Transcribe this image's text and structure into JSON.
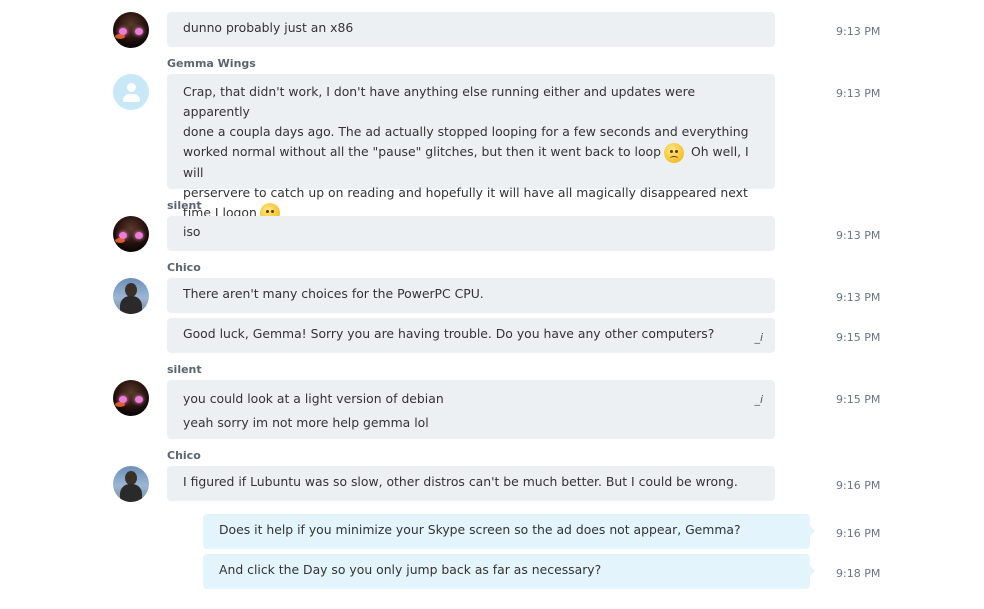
{
  "messages": [
    {
      "sender": "silent",
      "text": "dunno probably just an x86",
      "time": "9:13 PM"
    },
    {
      "sender": "Gemma Wings",
      "text_lines": [
        "Crap, that didn't work, I don't have anything else running either and updates were apparently",
        "done a coupla days ago.  The ad actually stopped looping for a few seconds and everything",
        "worked normal without all the \"pause\" glitches, but then it went back to loop",
        "Oh well, I will",
        "perservere to catch up on reading and hopefully it will have all magically disappeared next",
        "time I logon"
      ],
      "time": "9:13 PM"
    },
    {
      "sender": "silent",
      "text": "iso",
      "time": "9:13 PM"
    },
    {
      "sender": "Chico",
      "text": "There aren't many choices for the PowerPC CPU.",
      "time": "9:13 PM"
    },
    {
      "sender": "Chico",
      "text": "Good luck, Gemma!  Sorry you are having trouble.  Do you have any other computers?",
      "time": "9:15 PM",
      "edited_mark": "_i"
    },
    {
      "sender": "silent",
      "text_lines": [
        "you could look at a light version of debian",
        "yeah sorry im not more help gemma lol"
      ],
      "time": "9:15 PM",
      "edited_mark": "_i"
    },
    {
      "sender": "Chico",
      "text": "I figured if Lubuntu was so slow, other distros can't be much better.  But I could be wrong.",
      "time": "9:16 PM"
    },
    {
      "sender": "me",
      "text": "Does it help if you minimize your Skype screen so the ad does not appear, Gemma?",
      "time": "9:16 PM"
    },
    {
      "sender": "me",
      "text": "And click the  Day so you only jump back as far as necessary?",
      "time": "9:18 PM"
    }
  ],
  "colors": {
    "other_bubble": "#edf0f3",
    "own_bubble": "#e4f4fc"
  }
}
